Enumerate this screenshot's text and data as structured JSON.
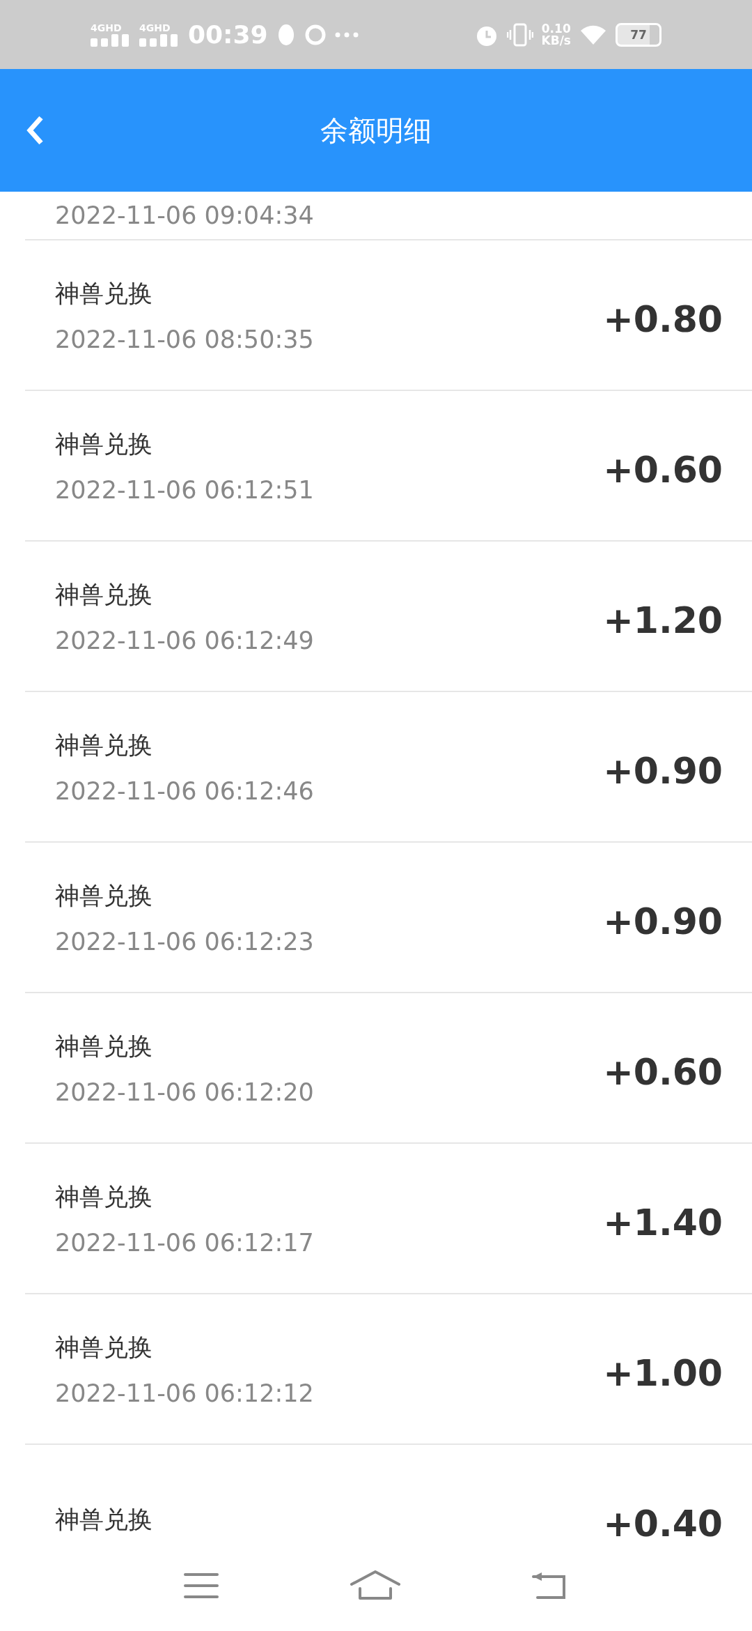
{
  "status_bar": {
    "networks": [
      "4GHD",
      "4GHD"
    ],
    "time": "00:39",
    "speed": "0.10",
    "speed_unit": "KB/s",
    "battery": "77"
  },
  "header": {
    "title": "余额明细"
  },
  "records": [
    {
      "time": "2022-11-06 09:04:34"
    },
    {
      "title": "神兽兑换",
      "time": "2022-11-06 08:50:35",
      "amount": "+0.80"
    },
    {
      "title": "神兽兑换",
      "time": "2022-11-06 06:12:51",
      "amount": "+0.60"
    },
    {
      "title": "神兽兑换",
      "time": "2022-11-06 06:12:49",
      "amount": "+1.20"
    },
    {
      "title": "神兽兑换",
      "time": "2022-11-06 06:12:46",
      "amount": "+0.90"
    },
    {
      "title": "神兽兑换",
      "time": "2022-11-06 06:12:23",
      "amount": "+0.90"
    },
    {
      "title": "神兽兑换",
      "time": "2022-11-06 06:12:20",
      "amount": "+0.60"
    },
    {
      "title": "神兽兑换",
      "time": "2022-11-06 06:12:17",
      "amount": "+1.40"
    },
    {
      "title": "神兽兑换",
      "time": "2022-11-06 06:12:12",
      "amount": "+1.00"
    },
    {
      "title": "神兽兑换",
      "amount": "+0.40"
    }
  ]
}
